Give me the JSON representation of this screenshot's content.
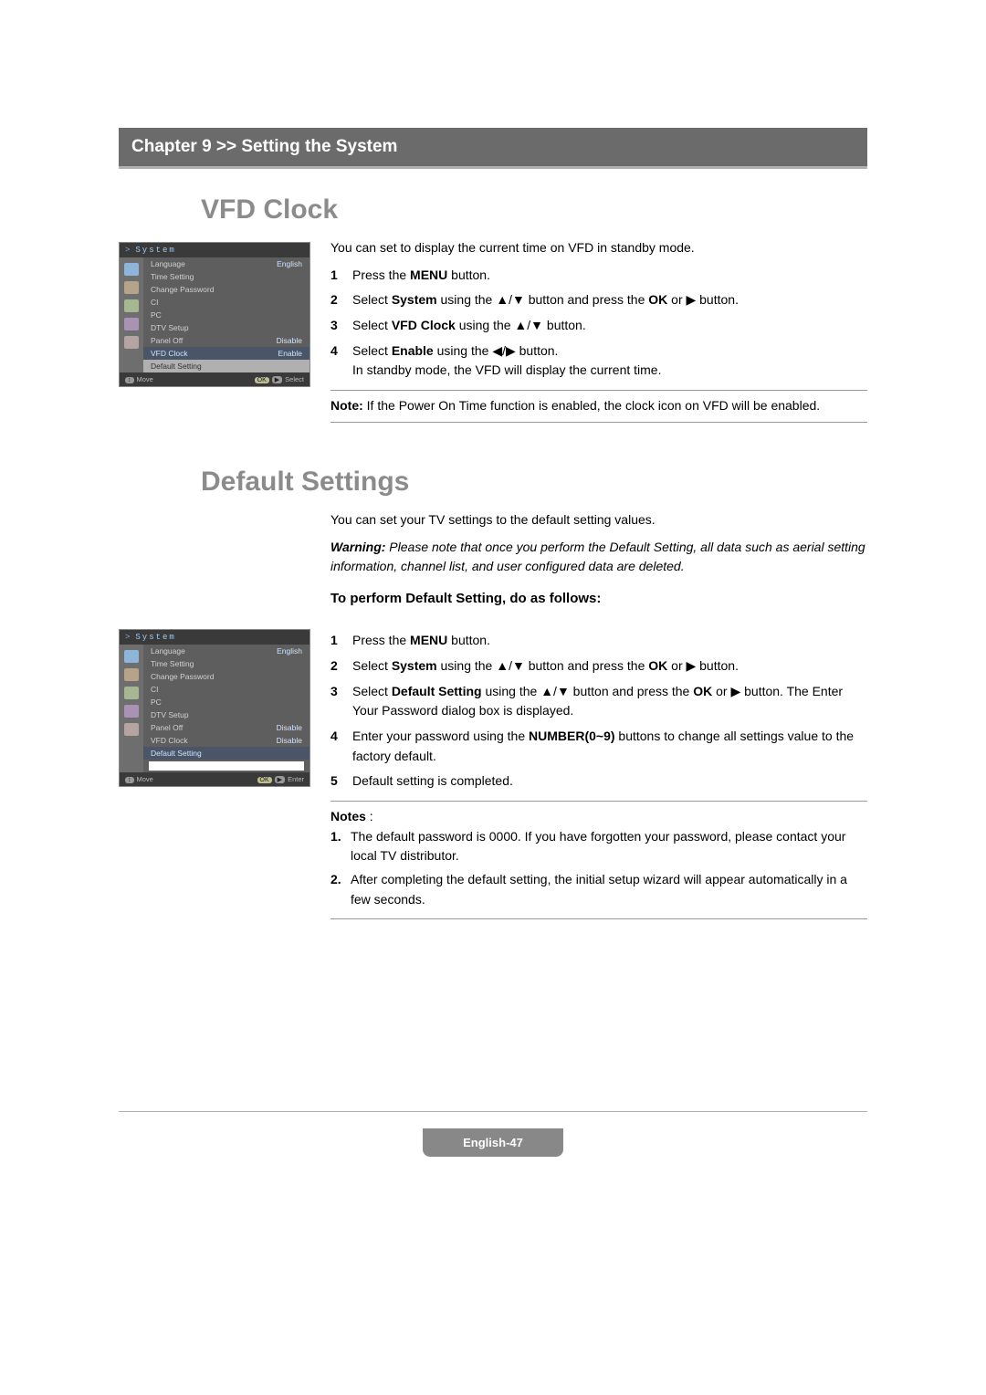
{
  "chapter_bar": "Chapter 9 >> Setting the System",
  "page_number_label": "English-47",
  "osd": {
    "title": "System",
    "items": [
      {
        "label": "Language",
        "value": "English"
      },
      {
        "label": "Time Setting",
        "value": ""
      },
      {
        "label": "Change Password",
        "value": ""
      },
      {
        "label": "CI",
        "value": ""
      },
      {
        "label": "PC",
        "value": ""
      },
      {
        "label": "DTV Setup",
        "value": ""
      },
      {
        "label": "Panel Off",
        "value": "Disable"
      },
      {
        "label": "VFD Clock",
        "value": "Enable"
      },
      {
        "label": "Default Setting",
        "value": ""
      }
    ],
    "items2": [
      {
        "label": "Language",
        "value": "English"
      },
      {
        "label": "Time Setting",
        "value": ""
      },
      {
        "label": "Change Password",
        "value": ""
      },
      {
        "label": "CI",
        "value": ""
      },
      {
        "label": "PC",
        "value": ""
      },
      {
        "label": "DTV Setup",
        "value": ""
      },
      {
        "label": "Panel Off",
        "value": "Disable"
      },
      {
        "label": "VFD Clock",
        "value": "Disable"
      },
      {
        "label": "Default Setting",
        "value": ""
      }
    ],
    "footer_move": "Move",
    "footer_select": "Select",
    "footer_enter": "Enter",
    "footer_nav_icon": "↕",
    "footer_ok": "OK",
    "footer_play": "▶"
  },
  "vfd": {
    "title": "VFD Clock",
    "intro": "You can set to display the current time on VFD in standby mode.",
    "steps": [
      "Press the <b>MENU</b> button.",
      "Select <b>System</b> using the ▲/▼ button and press the <b>OK</b> or ▶ button.",
      "Select <b>VFD Clock</b> using the ▲/▼ button.",
      "Select <b>Enable</b> using the ◀/▶ button.<br>In standby mode, the VFD will display the current time."
    ],
    "note": "<b>Note:</b> If the Power On Time function is enabled, the clock icon on VFD will be enabled."
  },
  "defaults": {
    "title": "Default Settings",
    "intro": "You can set your TV settings to the default setting values.",
    "warning": "<b>Warning:</b> Please note that once you perform the Default Setting, all data such as aerial setting information, channel list, and user configured data are deleted.",
    "subhead": "To perform Default Setting, do as follows:",
    "steps": [
      "Press the <b>MENU</b> button.",
      "Select <b>System</b> using the ▲/▼ button and press the <b>OK</b> or ▶ button.",
      "Select <b>Default Setting</b> using the ▲/▼ button and press the <b>OK</b> or ▶ button. The Enter Your Password dialog box is displayed.",
      "Enter your password using the <b>NUMBER(0~9)</b> buttons to change all settings value to the factory default.",
      "Default setting is completed."
    ],
    "notes_label": "Notes",
    "notes": [
      "The default password is 0000. If you have forgotten your password, please contact your local TV distributor.",
      "After completing the default setting, the initial setup wizard will appear automatically in a few seconds."
    ]
  }
}
